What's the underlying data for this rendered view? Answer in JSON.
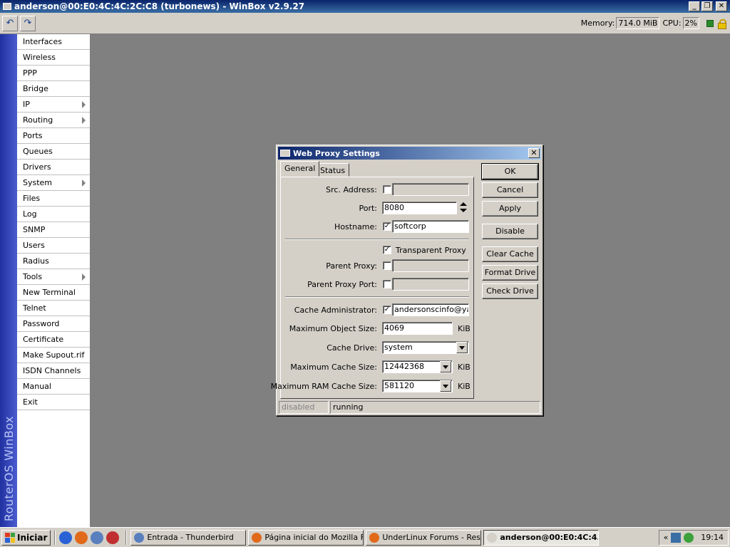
{
  "window": {
    "title": "anderson@00:E0:4C:4C:2C:C8 (turbonews) - WinBox v2.9.27"
  },
  "toolbar": {
    "memory_label": "Memory:",
    "memory_value": "714.0 MiB",
    "cpu_label": "CPU:",
    "cpu_value": "2%"
  },
  "brand": "RouterOS WinBox",
  "sidebar": {
    "items": [
      {
        "label": "Interfaces",
        "submenu": false
      },
      {
        "label": "Wireless",
        "submenu": false
      },
      {
        "label": "PPP",
        "submenu": false
      },
      {
        "label": "Bridge",
        "submenu": false
      },
      {
        "label": "IP",
        "submenu": true
      },
      {
        "label": "Routing",
        "submenu": true
      },
      {
        "label": "Ports",
        "submenu": false
      },
      {
        "label": "Queues",
        "submenu": false
      },
      {
        "label": "Drivers",
        "submenu": false
      },
      {
        "label": "System",
        "submenu": true
      },
      {
        "label": "Files",
        "submenu": false
      },
      {
        "label": "Log",
        "submenu": false
      },
      {
        "label": "SNMP",
        "submenu": false
      },
      {
        "label": "Users",
        "submenu": false
      },
      {
        "label": "Radius",
        "submenu": false
      },
      {
        "label": "Tools",
        "submenu": true
      },
      {
        "label": "New Terminal",
        "submenu": false
      },
      {
        "label": "Telnet",
        "submenu": false
      },
      {
        "label": "Password",
        "submenu": false
      },
      {
        "label": "Certificate",
        "submenu": false
      },
      {
        "label": "Make Supout.rif",
        "submenu": false
      },
      {
        "label": "ISDN Channels",
        "submenu": false
      },
      {
        "label": "Manual",
        "submenu": false
      },
      {
        "label": "Exit",
        "submenu": false
      }
    ]
  },
  "dialog": {
    "title": "Web Proxy Settings",
    "close": "✕",
    "tabs": {
      "general": "General",
      "status": "Status"
    },
    "fields": {
      "src_address": {
        "label": "Src. Address:",
        "checked": false,
        "value": ""
      },
      "port": {
        "label": "Port:",
        "value": "8080"
      },
      "hostname": {
        "label": "Hostname:",
        "checked": true,
        "value": "softcorp"
      },
      "transparent_proxy": {
        "label": "Transparent Proxy",
        "checked": true
      },
      "parent_proxy": {
        "label": "Parent Proxy:",
        "checked": false,
        "value": ""
      },
      "parent_proxy_port": {
        "label": "Parent Proxy Port:",
        "checked": false,
        "value": ""
      },
      "cache_administrator": {
        "label": "Cache Administrator:",
        "checked": true,
        "value": "andersonscinfo@yah"
      },
      "max_object_size": {
        "label": "Maximum Object Size:",
        "value": "4069",
        "unit": "KiB"
      },
      "cache_drive": {
        "label": "Cache Drive:",
        "value": "system"
      },
      "max_cache_size": {
        "label": "Maximum Cache Size:",
        "value": "12442368",
        "unit": "KiB"
      },
      "max_ram_cache_size": {
        "label": "Maximum RAM Cache Size:",
        "value": "581120",
        "unit": "KiB"
      }
    },
    "buttons": {
      "ok": "OK",
      "cancel": "Cancel",
      "apply": "Apply",
      "disable": "Disable",
      "clear_cache": "Clear Cache",
      "format_drive": "Format Drive",
      "check_drive": "Check Drive"
    },
    "status": {
      "left": "disabled",
      "right": "running"
    }
  },
  "taskbar": {
    "start": "Iniciar",
    "tasks": [
      {
        "label": "Entrada - Thunderbird",
        "color": "#5a7fbf",
        "active": false
      },
      {
        "label": "Página inicial do Mozilla Fi...",
        "color": "#e06a1a",
        "active": false
      },
      {
        "label": "UnderLinux Forums - Res...",
        "color": "#e06a1a",
        "active": false
      },
      {
        "label": "anderson@00:E0:4C:4...",
        "color": "#d4d0c8",
        "active": true
      }
    ],
    "tray_expand": "«",
    "clock": "19:14"
  },
  "colors": {
    "title_bar": "#0a246a",
    "brand_bar": "#2030a0",
    "workspace": "#808080",
    "status_led": "#2a8a2a"
  }
}
